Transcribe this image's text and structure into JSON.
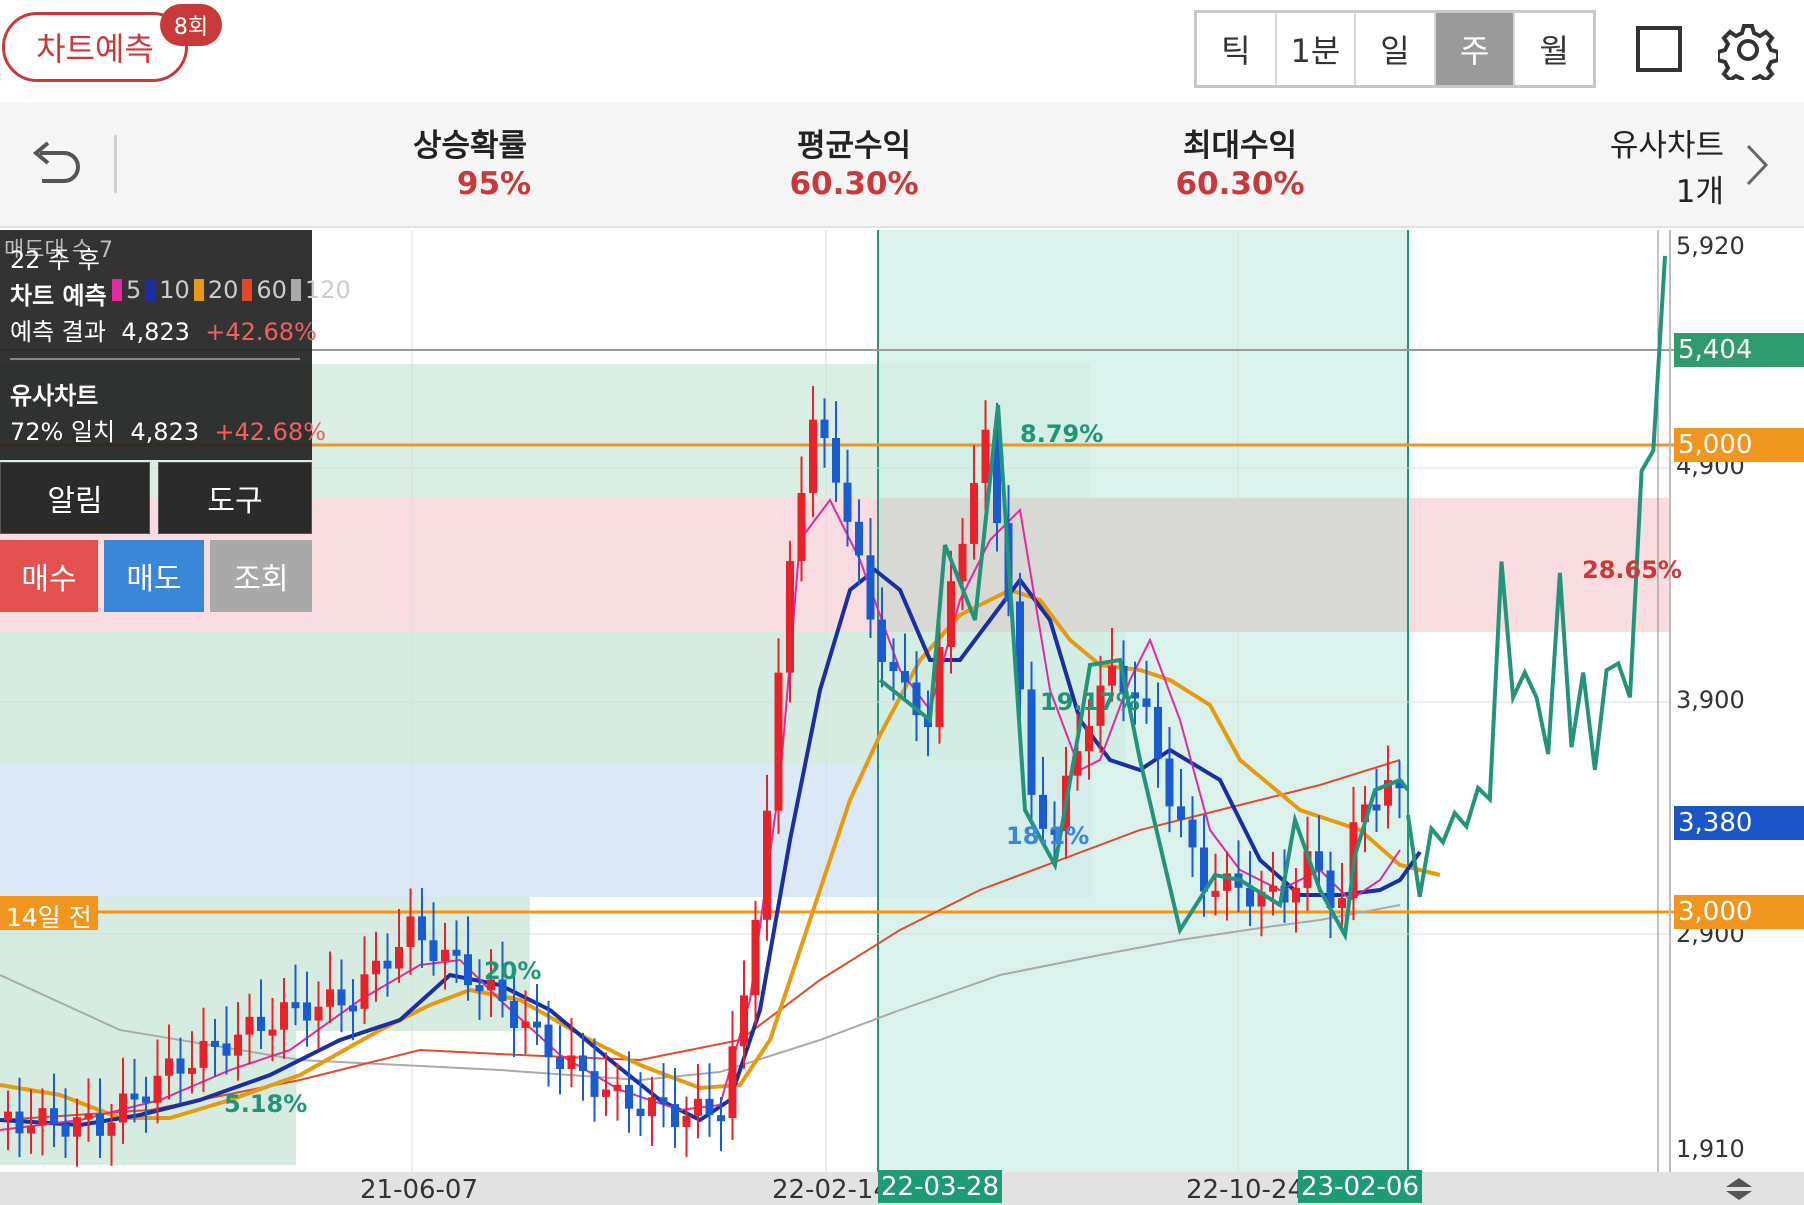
{
  "header": {
    "predict_label": "차트예측",
    "predict_badge": "8회",
    "tabs": [
      {
        "label": "틱",
        "active": false
      },
      {
        "label": "1분",
        "active": false
      },
      {
        "label": "일",
        "active": false
      },
      {
        "label": "주",
        "active": true
      },
      {
        "label": "월",
        "active": false
      }
    ]
  },
  "stats": {
    "rise_prob_label": "상승확률",
    "rise_prob_value": "95%",
    "avg_return_label": "평균수익",
    "avg_return_value": "60.30%",
    "max_return_label": "최대수익",
    "max_return_value": "60.30%",
    "similar_label": "유사차트",
    "similar_count": "1개"
  },
  "info_panel": {
    "weeks_after": "22 주 후",
    "predict_title": "차트 예측",
    "predict_result_label": "예측 결과",
    "predict_result_price": "4,823",
    "predict_result_pct": "+42.68%",
    "similar_title": "유사차트",
    "similar_match": "72% 일치",
    "similar_price": "4,823",
    "similar_pct": "+42.68%",
    "bg_text_1": "매도대 수 7",
    "ma_legend": [
      "5",
      "10",
      "20",
      "60",
      "120"
    ],
    "orange_left_label": "14일 전"
  },
  "buttons": {
    "alert": "알림",
    "tools": "도구",
    "buy": "매수",
    "sell": "매도",
    "inquiry": "조회"
  },
  "price_axis": {
    "ticks": [
      "5,920",
      "4,900",
      "3,900",
      "2,900",
      "1,910"
    ],
    "tags": [
      {
        "value": "5,404",
        "color": "#2e9a6e"
      },
      {
        "value": "5,000",
        "color": "#f0961e"
      },
      {
        "value": "3,380",
        "color": "#1a56c8"
      },
      {
        "value": "3,000",
        "color": "#f0961e"
      }
    ]
  },
  "x_axis": {
    "labels": [
      "21-06-07",
      "22-02-14",
      "22-10-24"
    ],
    "highlighted": [
      "22-03-28",
      "23-02-06"
    ]
  },
  "annotations": {
    "left_orange_label": "14일 전",
    "pct_labels": [
      "8.79%",
      "19.17%",
      "18.1%",
      "20%",
      "5.18%",
      "28.65%"
    ]
  },
  "chart_data": {
    "type": "candlestick",
    "price_ticks": [
      5920,
      4900,
      3900,
      2900,
      1910
    ],
    "reference_lines": [
      5404,
      5000,
      3000
    ],
    "current_price": 3380,
    "predicted_path": [
      3380,
      3020,
      3320,
      3260,
      3390,
      3330,
      3500,
      3450,
      4500,
      3900,
      4010,
      3900,
      3650,
      4450,
      3680,
      4010,
      3580,
      4020,
      4050,
      3900,
      4900,
      4990,
      5850
    ],
    "x_labels": [
      "21-06-07",
      "22-02-14",
      "22-10-24"
    ],
    "highlight_window": [
      "22-03-28",
      "23-02-06"
    ]
  },
  "colors": {
    "accent_red": "#c9393a",
    "buy_red": "#e25050",
    "sell_blue": "#3a86d8",
    "up_candle": "#e8222a",
    "down_candle": "#1a5bd0",
    "prediction_green": "#23937a",
    "highlight_teal": "#d8f1ec"
  }
}
